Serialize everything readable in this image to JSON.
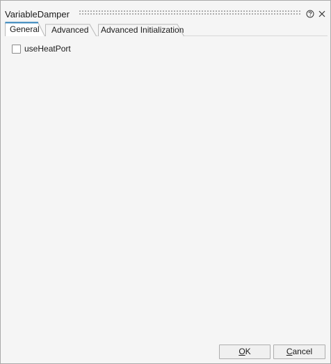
{
  "dialog": {
    "title": "VariableDamper",
    "help_icon": "help-circle-icon",
    "close_icon": "close-icon"
  },
  "tabs": [
    {
      "label": "General",
      "active": true
    },
    {
      "label": "Advanced",
      "active": false
    },
    {
      "label": "Advanced Initialization",
      "active": false
    }
  ],
  "general": {
    "use_heat_port": {
      "label": "useHeatPort",
      "checked": false
    }
  },
  "buttons": {
    "ok": {
      "mnemonic": "O",
      "rest": "K"
    },
    "cancel": {
      "mnemonic": "C",
      "rest": "ancel"
    }
  },
  "colors": {
    "active_tab_accent": "#2c7fb8",
    "dialog_background": "#f5f5f5"
  }
}
